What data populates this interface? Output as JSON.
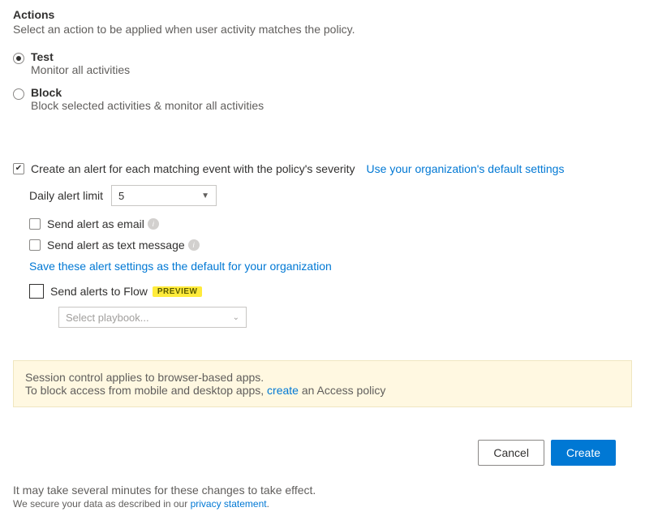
{
  "section": {
    "title": "Actions",
    "subtitle": "Select an action to be applied when user activity matches the policy."
  },
  "radios": {
    "test": {
      "label": "Test",
      "desc": "Monitor all activities"
    },
    "block": {
      "label": "Block",
      "desc": "Block selected activities & monitor all activities"
    }
  },
  "alert": {
    "create_label": "Create an alert for each matching event with the policy's severity",
    "use_default_link": "Use your organization's default settings",
    "daily_limit_label": "Daily alert limit",
    "daily_limit_value": "5",
    "send_email": "Send alert as email",
    "send_sms": "Send alert as text message",
    "save_default_link": "Save these alert settings as the default for your organization",
    "send_flow": "Send alerts to Flow",
    "preview_badge": "PREVIEW",
    "playbook_placeholder": "Select playbook..."
  },
  "banner": {
    "line1": "Session control applies to browser-based apps.",
    "line2_a": "To block access from mobile and desktop apps, ",
    "line2_link": "create",
    "line2_b": " an Access policy"
  },
  "buttons": {
    "cancel": "Cancel",
    "create": "Create"
  },
  "footnote": {
    "line": "It may take several minutes for these changes to take effect.",
    "privacy_a": "We secure your data as described in our ",
    "privacy_link": "privacy statement",
    "privacy_b": "."
  }
}
